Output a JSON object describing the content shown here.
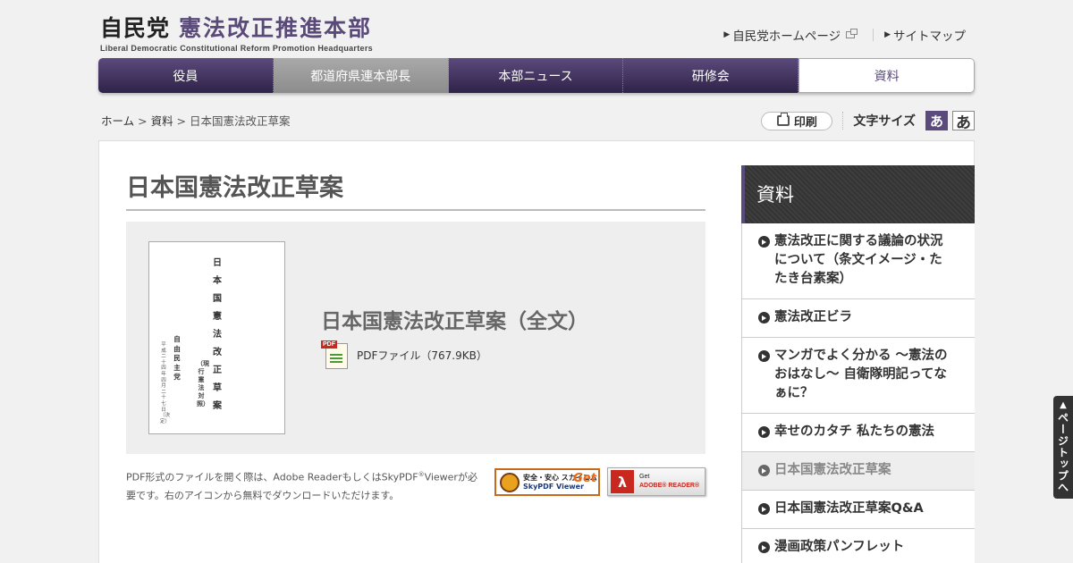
{
  "header": {
    "logo_ldp": "自民党",
    "logo_hq": "憲法改正推進本部",
    "logo_en": "Liberal Democratic Constitutional Reform Promotion Headquarters",
    "links": [
      "自民党ホームページ",
      "サイトマップ"
    ]
  },
  "nav": {
    "items": [
      "役員",
      "都道府県連本部長",
      "本部ニュース",
      "研修会",
      "資料"
    ],
    "active": "資料"
  },
  "breadcrumb": {
    "home": "ホーム",
    "sep1": " > ",
    "section": "資料",
    "sep2": " > ",
    "current": "日本国憲法改正草案"
  },
  "tools": {
    "print_label": "印刷",
    "font_size_label": "文字サイズ",
    "font_small": "あ",
    "font_large": "あ"
  },
  "main": {
    "title": "日本国憲法改正草案",
    "cover": {
      "title": "日本国憲法改正草案",
      "subtitle": "（現行憲法対照）",
      "party": "自由民主党",
      "date": "平成二十四年四月二十七日（決定）"
    },
    "document_title": "日本国憲法改正草案（全文）",
    "pdf_icon_label": "PDF",
    "pdf_label": "PDFファイル（767.9KB）",
    "note_part1": "PDF形式のファイルを開く際は、Adobe ReaderもしくはSkyPDF",
    "note_reg": "®",
    "note_part2": "Viewerが必要です。右のアイコンから無料でダウンロードいただけます。",
    "skypdf_badge": {
      "line1": "安全・安心 スカイコム",
      "line2": "SkyPDF Viewer",
      "get": "Get"
    },
    "adobe_badge": {
      "get": "Get",
      "product": "ADOBE® READER®"
    }
  },
  "sidebar": {
    "heading": "資料",
    "items": [
      "憲法改正に関する議論の状況について（条文イメージ・たたき台素案）",
      "憲法改正ビラ",
      "マンガでよく分かる ～憲法のおはなし～ 自衛隊明記ってなぁに？",
      "幸せのカタチ 私たちの憲法",
      "日本国憲法改正草案",
      "日本国憲法改正草案Q&A",
      "漫画政策パンフレット"
    ],
    "current_index": 4
  },
  "pagetop": {
    "label": "ページトップへ"
  },
  "colors": {
    "brand_purple": "#5b4a7c",
    "nav_dark": "#2f2348"
  }
}
